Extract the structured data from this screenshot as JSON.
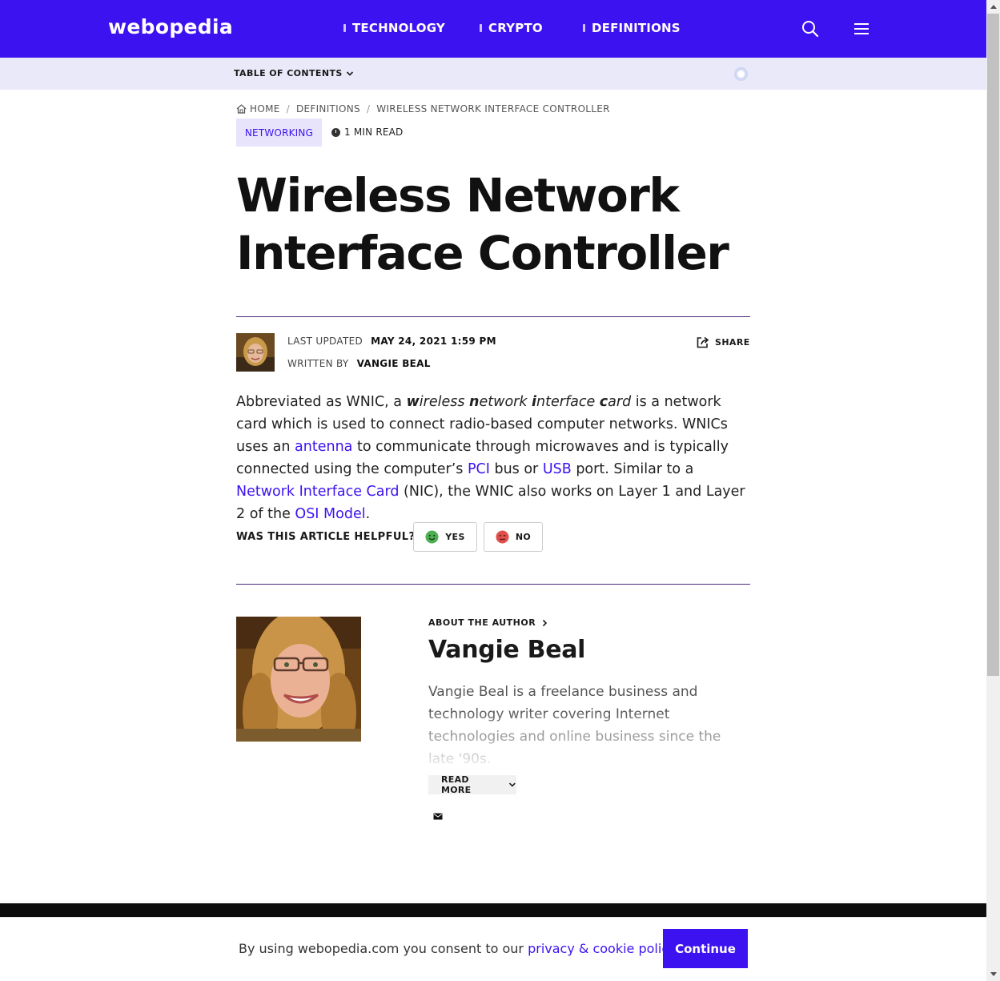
{
  "header": {
    "logo": "webopedia",
    "nav": [
      "TECHNOLOGY",
      "CRYPTO",
      "DEFINITIONS"
    ],
    "search_icon": "search-icon",
    "menu_icon": "hamburger-menu-icon",
    "background_color": "#3d12f0"
  },
  "toc": {
    "label": "TABLE OF CONTENTS"
  },
  "breadcrumb": {
    "home": "HOME",
    "level1": "DEFINITIONS",
    "level2": "WIRELESS NETWORK INTERFACE CONTROLLER"
  },
  "article": {
    "category": "NETWORKING",
    "read_time": "1 MIN READ",
    "title": "Wireless Network Interface Controller",
    "last_updated_label": "LAST UPDATED",
    "last_updated_value": "MAY 24, 2021 1:59 PM",
    "written_by_label": "WRITTEN BY",
    "author": "VANGIE BEAL",
    "share_label": "SHARE",
    "body": {
      "p1_a": "Abbreviated as WNIC, a ",
      "term_w": "w",
      "term_ireless": "ireless ",
      "term_n": "n",
      "term_etwork": "etwork ",
      "term_i": "i",
      "term_nterface": "nterface ",
      "term_c": "c",
      "term_ard": "ard",
      "p1_b": " is a network card which is used to connect radio-based computer networks. WNICs uses an ",
      "link_antenna": "antenna",
      "p1_c": " to communicate through microwaves and is typically connected using the computer’s ",
      "link_pci": "PCI",
      "p1_d": " bus or ",
      "link_usb": "USB",
      "p1_e": " port. Similar to a ",
      "link_nic": "Network Interface Card",
      "p1_f": " (NIC), the WNIC also works on Layer 1 and Layer 2 of the ",
      "link_osi": "OSI Model",
      "p1_g": "."
    },
    "helpful_question": "WAS THIS ARTICLE HELPFUL?",
    "yes_label": "YES",
    "no_label": "NO"
  },
  "author_box": {
    "about_label": "ABOUT THE AUTHOR",
    "name": "Vangie Beal",
    "bio": "Vangie Beal is a freelance business and technology writer covering Internet technologies and online business since the late '90s.",
    "read_more": "READ MORE"
  },
  "cookie": {
    "text_before": "By using webopedia.com you consent to our ",
    "link": "privacy & cookie policy",
    "text_after": ".",
    "button": "Continue"
  }
}
